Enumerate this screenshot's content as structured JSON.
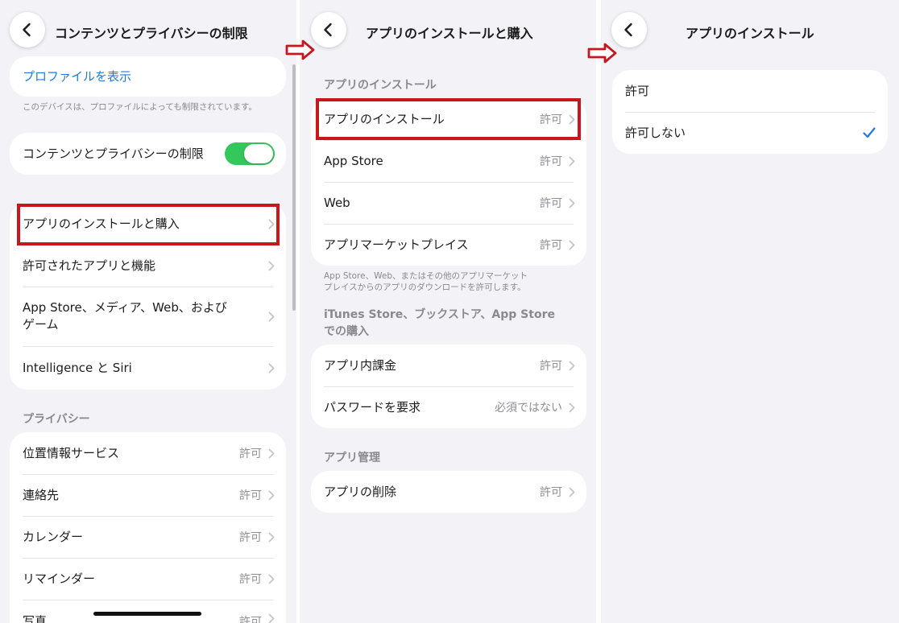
{
  "screen1": {
    "title": "コンテンツとプライバシーの制限",
    "profile_link": "プロファイルを表示",
    "profile_note": "このデバイスは、プロファイルによっても制限されています。",
    "toggle_label": "コンテンツとプライバシーの制限",
    "toggle_state": "on",
    "menu": [
      {
        "label": "アプリのインストールと購入"
      },
      {
        "label": "許可されたアプリと機能"
      },
      {
        "label": "App Store、メディア、Web、および\nゲーム"
      },
      {
        "label": "Intelligence と Siri"
      }
    ],
    "privacy_header": "プライバシー",
    "privacy": [
      {
        "label": "位置情報サービス",
        "value": "許可"
      },
      {
        "label": "連絡先",
        "value": "許可"
      },
      {
        "label": "カレンダー",
        "value": "許可"
      },
      {
        "label": "リマインダー",
        "value": "許可"
      },
      {
        "label": "写真",
        "value": "許可"
      }
    ]
  },
  "screen2": {
    "title": "アプリのインストールと購入",
    "section1_header": "アプリのインストール",
    "section1": [
      {
        "label": "アプリのインストール",
        "value": "許可"
      },
      {
        "label": "App Store",
        "value": "許可"
      },
      {
        "label": "Web",
        "value": "許可"
      },
      {
        "label": "アプリマーケットプレイス",
        "value": "許可"
      }
    ],
    "section1_note_1": "App Store、Web、またはその他のアプリマーケット",
    "section1_note_2": "プレイスからのアプリのダウンロードを許可します。",
    "section2_header_1": "iTunes Store、ブックストア、App Store",
    "section2_header_2": "での購入",
    "section2": [
      {
        "label": "アプリ内課金",
        "value": "許可"
      },
      {
        "label": "パスワードを要求",
        "value": "必須ではない"
      }
    ],
    "section3_header": "アプリ管理",
    "section3": [
      {
        "label": "アプリの削除",
        "value": "許可"
      }
    ]
  },
  "screen3": {
    "title": "アプリのインストール",
    "options": [
      {
        "label": "許可",
        "selected": false
      },
      {
        "label": "許可しない",
        "selected": true
      }
    ]
  },
  "colors": {
    "accent": "#1e7bd8",
    "toggle_on": "#34c759",
    "highlight": "#c8161d",
    "background": "#f2f2f7"
  },
  "icons": [
    "back-chevron-icon",
    "chevron-right-icon",
    "checkmark-icon",
    "red-arrow-icon"
  ]
}
